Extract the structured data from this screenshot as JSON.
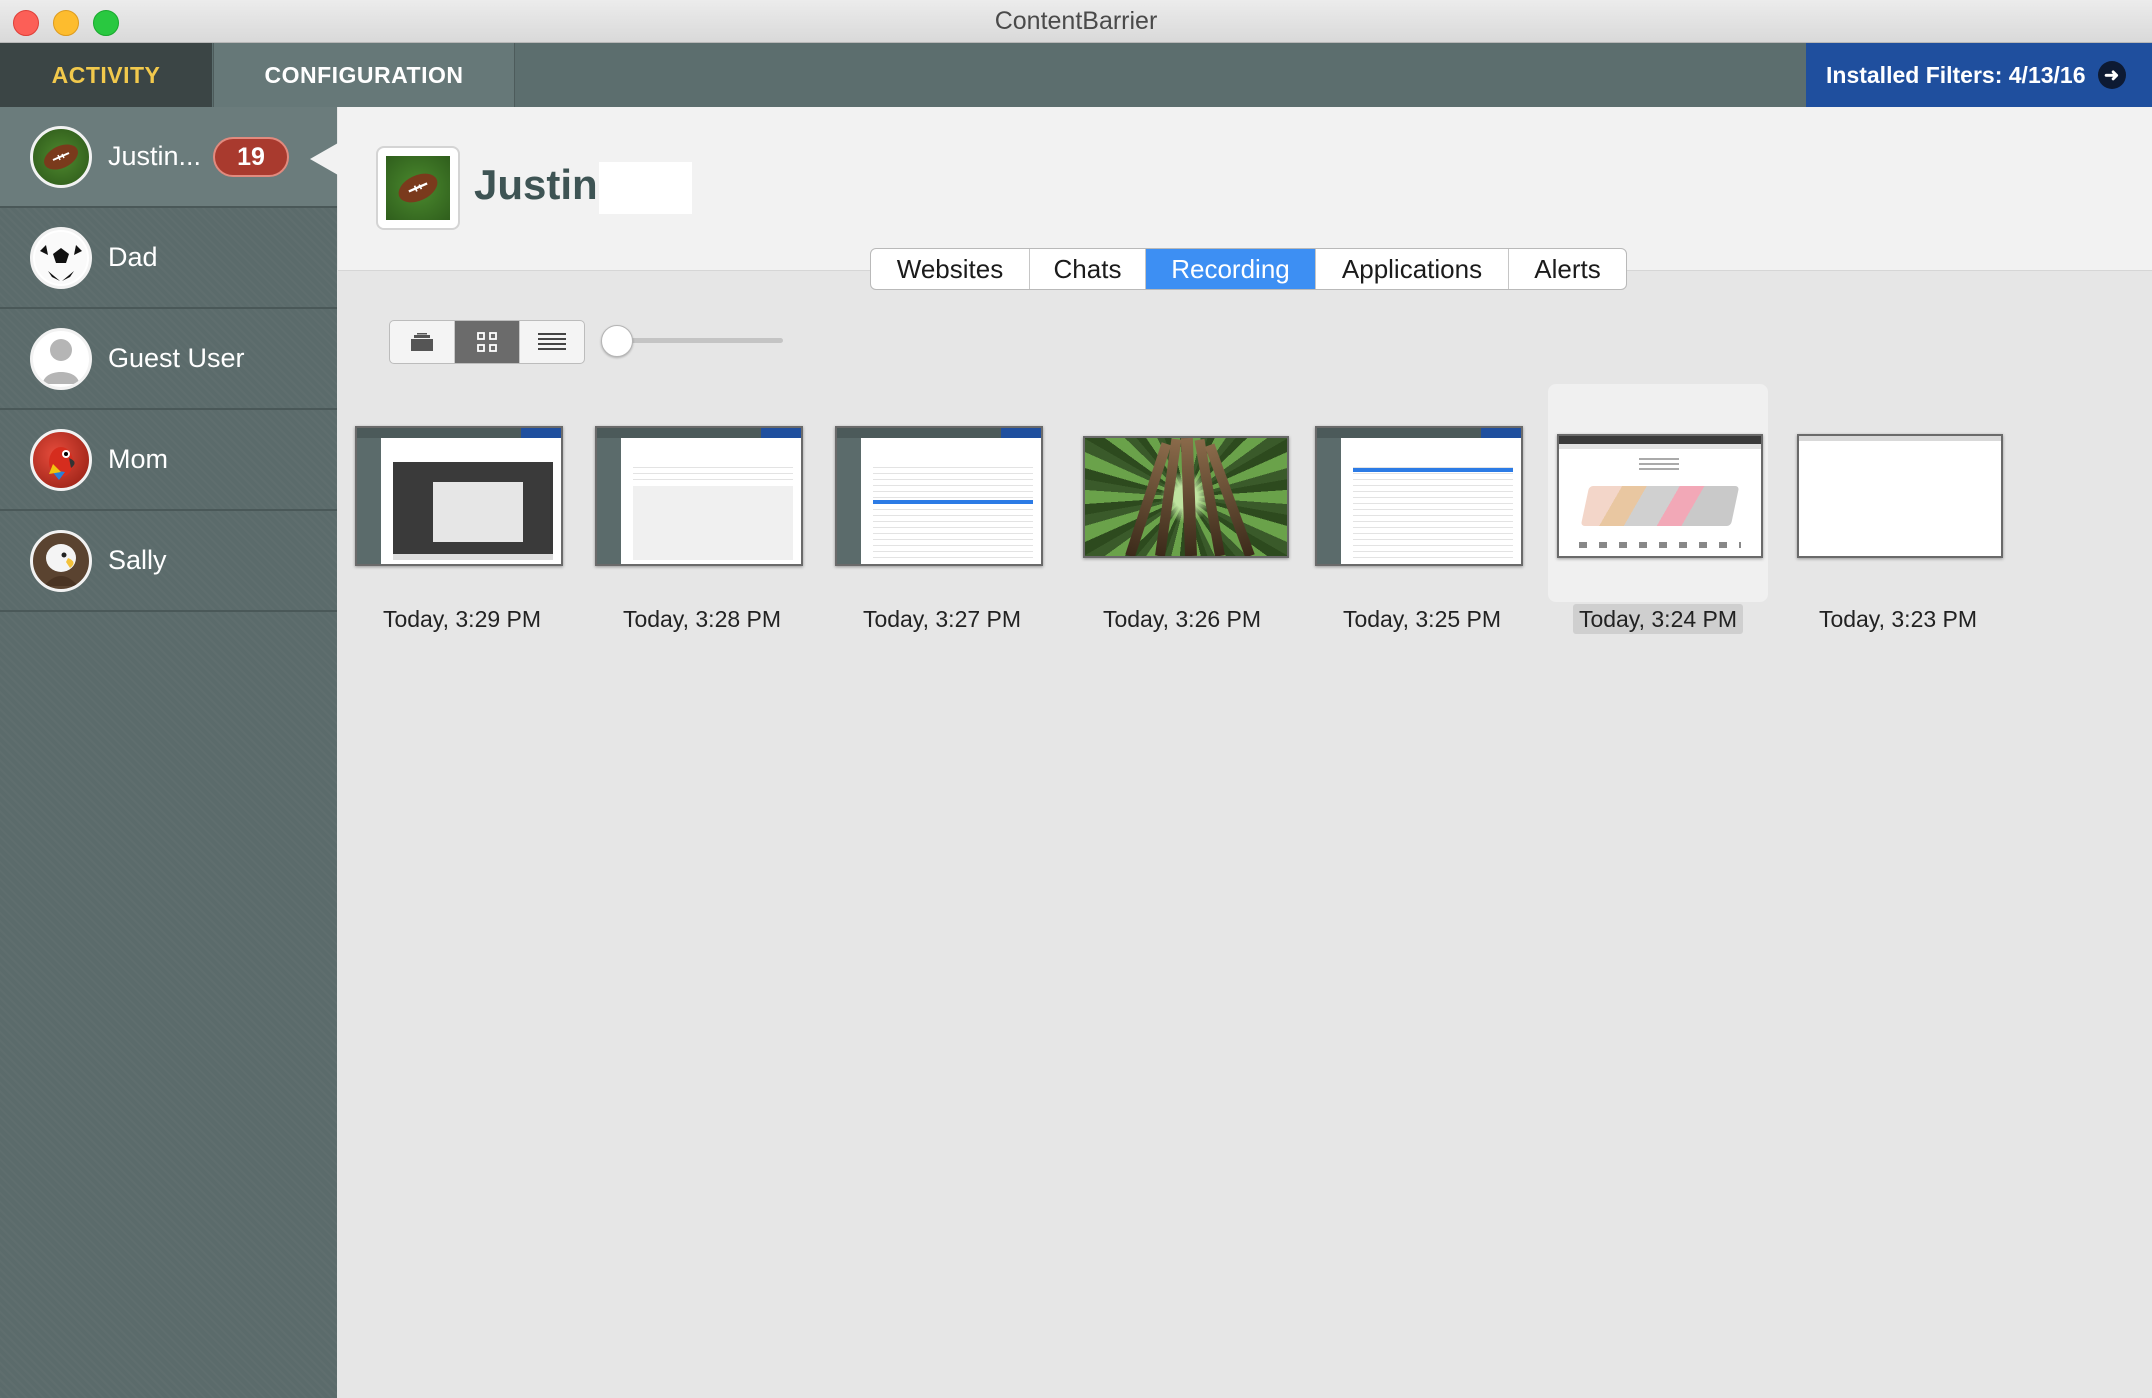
{
  "window": {
    "title": "ContentBarrier"
  },
  "nav": {
    "activity": "ACTIVITY",
    "configuration": "CONFIGURATION",
    "filters_label": "Installed Filters: 4/13/16"
  },
  "sidebar": {
    "users": [
      {
        "name": "Justin...",
        "badge": "19",
        "avatar": "football-icon",
        "selected": true
      },
      {
        "name": "Dad",
        "avatar": "soccer-ball-icon"
      },
      {
        "name": "Guest User",
        "avatar": "person-silhouette-icon"
      },
      {
        "name": "Mom",
        "avatar": "parrot-icon"
      },
      {
        "name": "Sally",
        "avatar": "eagle-icon"
      }
    ]
  },
  "header": {
    "name": "Justin",
    "avatar": "football-icon"
  },
  "tabs": [
    "Websites",
    "Chats",
    "Recording",
    "Applications",
    "Alerts"
  ],
  "active_tab": "Recording",
  "view_modes": [
    "cover-flow-icon",
    "grid-icon",
    "list-icon"
  ],
  "active_view": "grid-icon",
  "thumbnail_size": 0,
  "recordings": [
    {
      "time": "Today, 3:29 PM",
      "kind": "app-screen"
    },
    {
      "time": "Today, 3:28 PM",
      "kind": "app-screen"
    },
    {
      "time": "Today, 3:27 PM",
      "kind": "app-screen"
    },
    {
      "time": "Today, 3:26 PM",
      "kind": "forest-photo"
    },
    {
      "time": "Today, 3:25 PM",
      "kind": "app-screen"
    },
    {
      "time": "Today, 3:24 PM",
      "kind": "web-page",
      "selected": true
    },
    {
      "time": "Today, 3:23 PM",
      "kind": "blank-page"
    }
  ],
  "colors": {
    "accent_blue": "#3d8ff3",
    "filters_blue": "#1f4f9e",
    "activity_gold": "#f2c94c",
    "badge_red": "#a93a2e",
    "sidebar": "#5b6b6b"
  }
}
